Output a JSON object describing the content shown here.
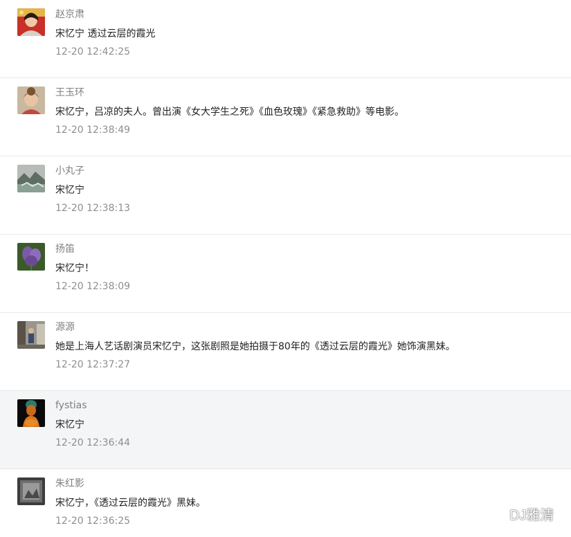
{
  "comments": [
    {
      "name": "赵京肃",
      "content": "宋忆宁  透过云层的霞光",
      "time": "12-20 12:42:25",
      "avatar_icon": "woman-portrait-red-avatar-icon"
    },
    {
      "name": "王玉环",
      "content": "宋忆宁，吕凉的夫人。曾出演《女大学生之死》《血色玫瑰》《紧急救助》等电影。",
      "time": "12-20 12:38:49",
      "avatar_icon": "woman-portrait-avatar-icon"
    },
    {
      "name": "小丸子",
      "content": "宋忆宁",
      "time": "12-20 12:38:13",
      "avatar_icon": "landscape-avatar-icon"
    },
    {
      "name": "扬笛",
      "content": "宋忆宁！",
      "time": "12-20 12:38:09",
      "avatar_icon": "purple-flower-avatar-icon"
    },
    {
      "name": "源源",
      "content": "她是上海人艺话剧演员宋忆宁，这张剧照是她拍摄于80年的《透过云层的霞光》她饰演黑妹。",
      "time": "12-20 12:37:27",
      "avatar_icon": "person-street-avatar-icon"
    },
    {
      "name": "fystias",
      "content": "宋忆宁",
      "time": "12-20 12:36:44",
      "avatar_icon": "buddha-statue-avatar-icon"
    },
    {
      "name": "朱红影",
      "content": "宋忆宁，《透过云层的霞光》黑妹。",
      "time": "12-20 12:36:25",
      "avatar_icon": "gray-photo-avatar-icon"
    }
  ],
  "watermark": {
    "text": "DJ雅清",
    "icon": "wechat-icon"
  },
  "colors": {
    "highlight_row": "#f4f5f7",
    "divider": "#e7e7e7",
    "meta_text": "#8e8e8e"
  }
}
